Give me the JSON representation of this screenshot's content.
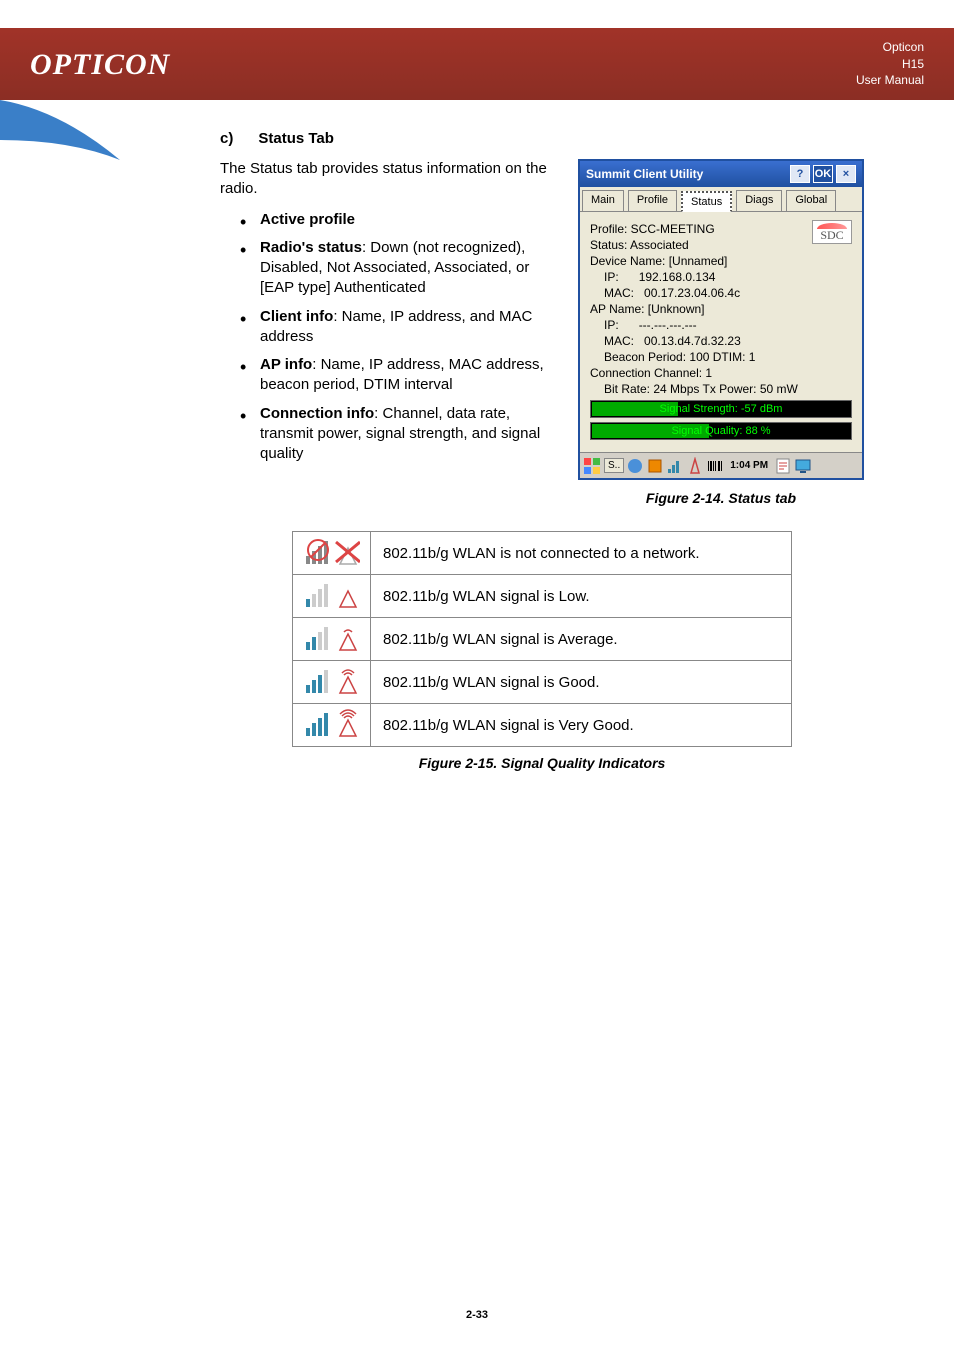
{
  "header": {
    "brand_line1": "Opticon",
    "brand_line2": "H15",
    "brand_line3": "User Manual"
  },
  "section": {
    "letter": "c)",
    "title": "Status Tab",
    "intro": "The Status tab provides status information on the radio."
  },
  "bullets": [
    {
      "label": "Active profile",
      "desc": ""
    },
    {
      "label": "Radio's status",
      "desc": ": Down (not recognized), Disabled, Not Associated, Associated, or [EAP type] Authenticated"
    },
    {
      "label": "Client info",
      "desc": ": Name, IP address, and MAC address"
    },
    {
      "label": "AP info",
      "desc": ": Name, IP address, MAC address, beacon period, DTIM interval"
    },
    {
      "label": "Connection info",
      "desc": ": Channel, data rate, transmit power, signal strength, and signal quality"
    }
  ],
  "device": {
    "window_title": "Summit Client Utility",
    "tabs": [
      "Main",
      "Profile",
      "Status",
      "Diags",
      "Global"
    ],
    "profile": "Profile: SCC-MEETING",
    "status": "Status: Associated",
    "device_name": "Device Name: [Unnamed]",
    "client_ip_label": "IP:",
    "client_ip": "192.168.0.134",
    "client_mac_label": "MAC:",
    "client_mac": "00.17.23.04.06.4c",
    "ap_name": "AP Name: [Unknown]",
    "ap_ip_label": "IP:",
    "ap_ip": "---.---.---.---",
    "ap_mac_label": "MAC:",
    "ap_mac": "00.13.d4.7d.32.23",
    "beacon": "Beacon Period: 100   DTIM: 1",
    "conn_channel": "Connection Channel:   1",
    "bit_rate": "Bit Rate: 24 Mbps  Tx Power:  50 mW",
    "sig_strength": "Signal Strength: -57 dBm",
    "sig_quality": "Signal Quality: 88 %",
    "sdc": "SDC",
    "taskbar_time": "1:04 PM",
    "taskbar_s": "S.."
  },
  "figure1_caption": "Figure 2-14. Status tab",
  "signal_rows": [
    "802.11b/g WLAN is not connected to a network.",
    "802.11b/g WLAN signal is Low.",
    "802.11b/g WLAN signal is Average.",
    "802.11b/g WLAN signal is Good.",
    "802.11b/g WLAN signal is Very Good."
  ],
  "figure2_caption": "Figure 2-15. Signal Quality Indicators",
  "page_number": "2-33"
}
